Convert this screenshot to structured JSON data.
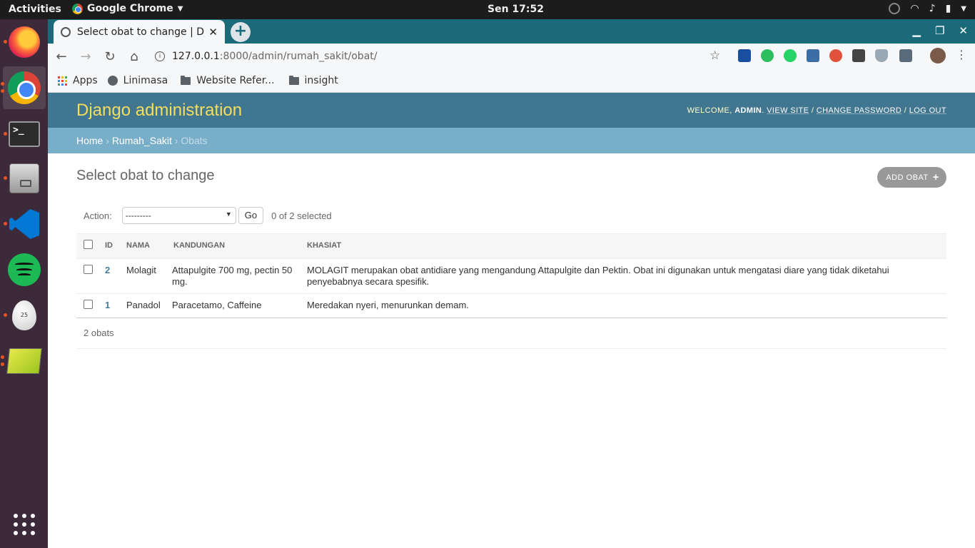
{
  "topbar": {
    "activities": "Activities",
    "app_name": "Google Chrome",
    "clock": "Sen 17:52"
  },
  "browser": {
    "tab_title": "Select obat to change | Dj",
    "url_host": "127.0.0.1",
    "url_path": ":8000/admin/rumah_sakit/obat/",
    "bookmarks": [
      "Apps",
      "Linimasa",
      "Website Refer...",
      "insight"
    ]
  },
  "admin": {
    "brand": "Django administration",
    "welcome": "WELCOME,",
    "username": "ADMIN",
    "view_site": "VIEW SITE",
    "change_password": "CHANGE PASSWORD",
    "log_out": "LOG OUT",
    "sep": "/",
    "breadcrumbs": {
      "home": "Home",
      "app": "Rumah_Sakit",
      "current": "Obats",
      "sep": "›"
    },
    "title": "Select obat to change",
    "add_button": "ADD OBAT",
    "action_label": "Action:",
    "action_selected": "---------",
    "go_label": "Go",
    "counter": "0 of 2 selected",
    "columns": [
      "ID",
      "NAMA",
      "KANDUNGAN",
      "KHASIAT"
    ],
    "rows": [
      {
        "id": "2",
        "nama": "Molagit",
        "kandungan": "Attapulgite 700 mg, pectin 50 mg.",
        "khasiat": "MOLAGIT merupakan obat antidiare yang mengandung Attapulgite dan Pektin. Obat ini digunakan untuk mengatasi diare yang tidak diketahui penyebabnya secara spesifik."
      },
      {
        "id": "1",
        "nama": "Panadol",
        "kandungan": "Paracetamo, Caffeine",
        "khasiat": "Meredakan nyeri, menurunkan demam."
      }
    ],
    "paginator": "2 obats"
  },
  "colors": {
    "header_bg": "#417690",
    "brand": "#f5dd5d",
    "breadcrumbs_bg": "#79aec8",
    "link": "#447e9b",
    "tabstrip": "#1b6a7a"
  }
}
